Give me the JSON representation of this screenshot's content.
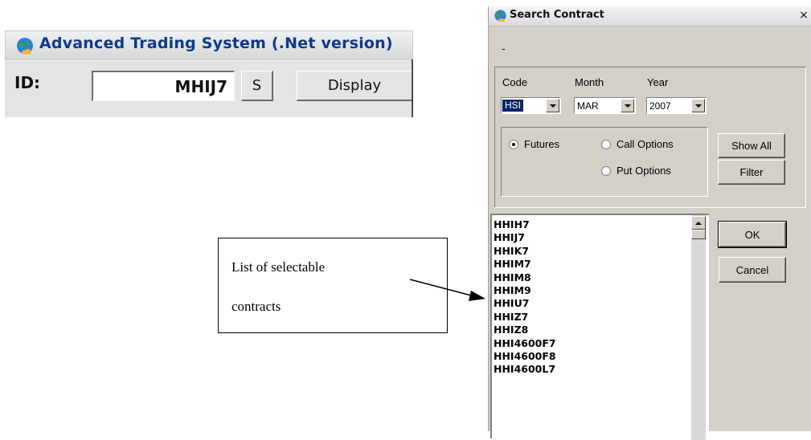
{
  "left_window": {
    "title": "Advanced Trading System (.Net version)",
    "id_label": "ID:",
    "id_value": "MHIJ7",
    "s_button": "S",
    "display_button": "Display"
  },
  "dialog": {
    "title": "Search Contract",
    "close_glyph": "×",
    "status_text": "-",
    "code_label": "Code",
    "code_value": "HSI",
    "month_label": "Month",
    "month_value": "MAR",
    "year_label": "Year",
    "year_value": "2007",
    "radio_futures": "Futures",
    "radio_call_options": "Call Options",
    "radio_put_options": "Put Options",
    "selected_type": "Futures",
    "show_all_button": "Show All",
    "filter_button": "Filter",
    "ok_button": "OK",
    "cancel_button": "Cancel",
    "contracts": [
      "HHIH7",
      "HHIJ7",
      "HHIK7",
      "HHIM7",
      "HHIM8",
      "HHIM9",
      "HHIU7",
      "HHIZ7",
      "HHIZ8",
      "HHI4600F7",
      "HHI4600F8",
      "HHI4600L7"
    ]
  },
  "annotation": {
    "line1": "List of selectable",
    "line2": "contracts"
  },
  "colors": {
    "title_blue": "#0d3a8c",
    "dialog_face": "#d4d0c8",
    "selection": "#0a246a"
  },
  "icons": {
    "app_icon": "globe-icon"
  }
}
